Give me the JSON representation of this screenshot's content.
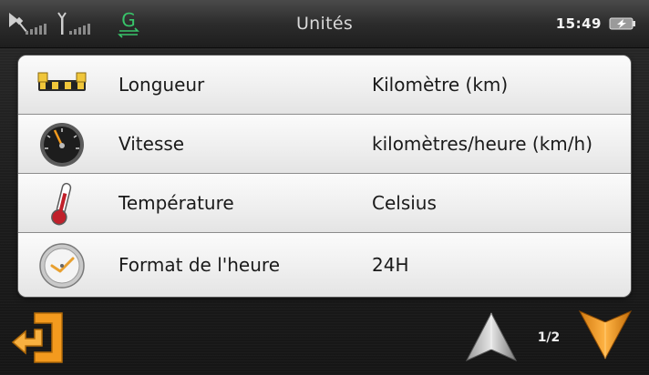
{
  "status_bar": {
    "title": "Unités",
    "time": "15:49",
    "gps_status_letter": "G",
    "icons": [
      "satellite-signal-icon",
      "cellular-signal-icon",
      "gprs-icon",
      "battery-charging-icon"
    ]
  },
  "settings": [
    {
      "id": "longueur",
      "icon": "ruler-icon",
      "label": "Longueur",
      "value": "Kilomètre (km)"
    },
    {
      "id": "vitesse",
      "icon": "speedometer-icon",
      "label": "Vitesse",
      "value": "kilomètres/heure (km/h)"
    },
    {
      "id": "temperature",
      "icon": "thermometer-icon",
      "label": "Température",
      "value": "Celsius"
    },
    {
      "id": "format-heure",
      "icon": "clock-icon",
      "label": "Format de l'heure",
      "value": "24H"
    }
  ],
  "navigation": {
    "page_indicator": "1/2",
    "icons": [
      "back-arrow-icon",
      "arrow-up-icon",
      "arrow-down-icon"
    ]
  },
  "colors": {
    "accent_orange": "#f39a1e",
    "gps_green": "#38c46a",
    "list_background": "#eeeeee"
  }
}
